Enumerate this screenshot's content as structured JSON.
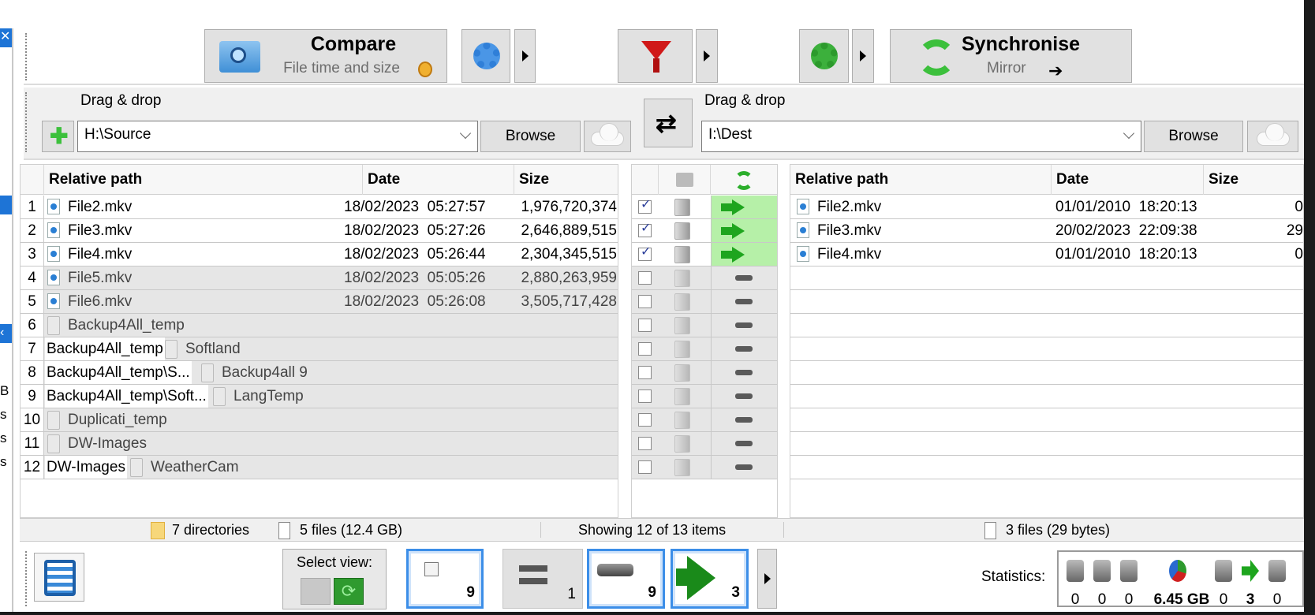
{
  "left_strip": {
    "fragments": [
      "B",
      "s",
      "s",
      "s"
    ]
  },
  "toolbar": {
    "compare_label": "Compare",
    "compare_variant": "File time and size",
    "sync_label": "Synchronise",
    "sync_variant": "Mirror"
  },
  "left_folder": {
    "drag_label": "Drag & drop",
    "path": "H:\\Source",
    "browse_label": "Browse"
  },
  "right_folder": {
    "drag_label": "Drag & drop",
    "path": "I:\\Dest",
    "browse_label": "Browse"
  },
  "left_grid": {
    "headers": {
      "path": "Relative path",
      "date": "Date",
      "size": "Size"
    },
    "rows": [
      {
        "num": "1",
        "parent": "",
        "name": "File2.mkv",
        "date": "18/02/2023  05:27:57",
        "size": "1,976,720,374",
        "kind": "file",
        "active": true
      },
      {
        "num": "2",
        "parent": "",
        "name": "File3.mkv",
        "date": "18/02/2023  05:27:26",
        "size": "2,646,889,515",
        "kind": "file",
        "active": true
      },
      {
        "num": "3",
        "parent": "",
        "name": "File4.mkv",
        "date": "18/02/2023  05:26:44",
        "size": "2,304,345,515",
        "kind": "file",
        "active": true
      },
      {
        "num": "4",
        "parent": "",
        "name": "File5.mkv",
        "date": "18/02/2023  05:05:26",
        "size": "2,880,263,959",
        "kind": "file",
        "active": false
      },
      {
        "num": "5",
        "parent": "",
        "name": "File6.mkv",
        "date": "18/02/2023  05:26:08",
        "size": "3,505,717,428",
        "kind": "file",
        "active": false
      },
      {
        "num": "6",
        "parent": "",
        "name": "Backup4All_temp",
        "date": "",
        "size": "",
        "kind": "folder",
        "active": false
      },
      {
        "num": "7",
        "parent": "Backup4All_temp",
        "name": "Softland",
        "date": "",
        "size": "",
        "kind": "folder",
        "active": false
      },
      {
        "num": "8",
        "parent": "Backup4All_temp\\S...",
        "name": "Backup4all 9",
        "date": "",
        "size": "",
        "kind": "folder",
        "active": false
      },
      {
        "num": "9",
        "parent": "Backup4All_temp\\Soft...",
        "name": "LangTemp",
        "date": "",
        "size": "",
        "kind": "folder",
        "active": false
      },
      {
        "num": "10",
        "parent": "",
        "name": "Duplicati_temp",
        "date": "",
        "size": "",
        "kind": "folder",
        "active": false
      },
      {
        "num": "11",
        "parent": "",
        "name": "DW-Images",
        "date": "",
        "size": "",
        "kind": "folder",
        "active": false
      },
      {
        "num": "12",
        "parent": "DW-Images",
        "name": "WeatherCam",
        "date": "",
        "size": "",
        "kind": "folder",
        "active": false
      }
    ]
  },
  "middle_grid": {
    "rows": [
      {
        "checked": true,
        "action": "copy-right"
      },
      {
        "checked": true,
        "action": "copy-right"
      },
      {
        "checked": true,
        "action": "copy-right"
      },
      {
        "checked": false,
        "action": "equal"
      },
      {
        "checked": false,
        "action": "equal"
      },
      {
        "checked": false,
        "action": "equal"
      },
      {
        "checked": false,
        "action": "equal"
      },
      {
        "checked": false,
        "action": "equal"
      },
      {
        "checked": false,
        "action": "equal"
      },
      {
        "checked": false,
        "action": "equal"
      },
      {
        "checked": false,
        "action": "equal"
      },
      {
        "checked": false,
        "action": "equal"
      }
    ]
  },
  "right_grid": {
    "headers": {
      "path": "Relative path",
      "date": "Date",
      "size": "Size"
    },
    "rows": [
      {
        "name": "File2.mkv",
        "date": "01/01/2010  18:20:13",
        "size": "0"
      },
      {
        "name": "File3.mkv",
        "date": "20/02/2023  22:09:38",
        "size": "29"
      },
      {
        "name": "File4.mkv",
        "date": "01/01/2010  18:20:13",
        "size": "0"
      }
    ]
  },
  "status_bar": {
    "left_dirs": "7 directories",
    "left_files": "5 files (12.4 GB)",
    "center": "Showing 12 of 13 items",
    "right_files": "3 files (29 bytes)"
  },
  "bottom": {
    "select_view_label": "Select view:",
    "view_buttons": [
      {
        "icon": "checkbox-icon",
        "count": "9",
        "selected": true
      },
      {
        "icon": "equal-icon",
        "count": "1",
        "selected": false
      },
      {
        "icon": "do-nothing-icon",
        "count": "9",
        "selected": true
      },
      {
        "icon": "copy-right-arrow-icon",
        "count": "3",
        "selected": true
      }
    ],
    "statistics_label": "Statistics:",
    "stats": [
      "0",
      "0",
      "0",
      "6.45 GB",
      "0",
      "3",
      "0"
    ]
  },
  "colors": {
    "accent_blue": "#3c8ee8",
    "sync_green": "#1ea51e",
    "filter_red": "#d01818",
    "action_bg": "#b6f0a8"
  }
}
